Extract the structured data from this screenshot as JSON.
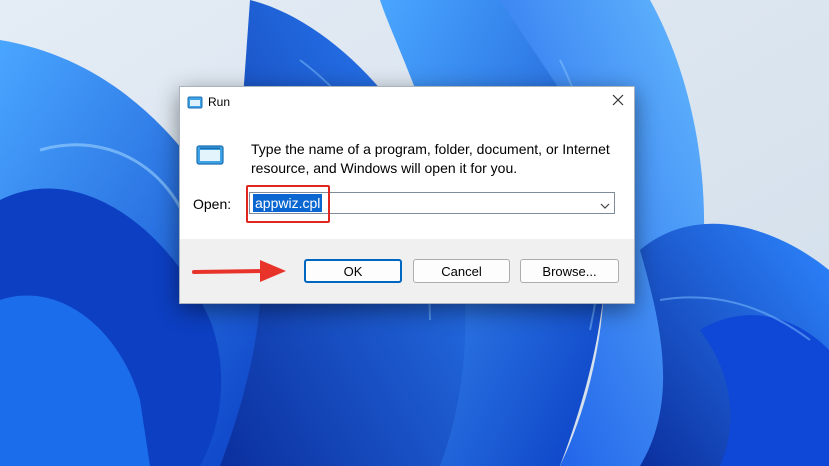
{
  "window": {
    "title": "Run",
    "description": "Type the name of a program, folder, document, or Internet resource, and Windows will open it for you."
  },
  "open_field": {
    "label": "Open:",
    "value": "appwiz.cpl"
  },
  "buttons": {
    "ok": "OK",
    "cancel": "Cancel",
    "browse": "Browse..."
  },
  "icons": {
    "title": "run-icon",
    "close": "close-icon",
    "program": "program-window-icon",
    "dropdown": "chevron-down-icon",
    "annotation_arrow": "arrow-right-icon"
  },
  "colors": {
    "selection": "#0a66d0",
    "annotation": "#e0261f",
    "default_button_border": "#0067c0",
    "footer": "#f0f0f0"
  }
}
